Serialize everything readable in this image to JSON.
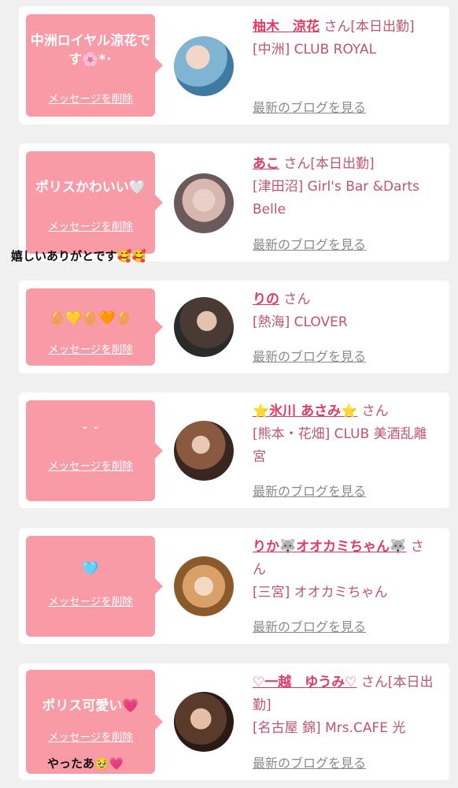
{
  "delete_label": "メッセージを削除",
  "blog_label": "最新のブログを見る",
  "honorific": "さん",
  "entries": [
    {
      "message": "中洲ロイヤル涼花です🌸*･",
      "name": "柚木　涼花",
      "status": "[本日出勤]",
      "shop": "[中洲] CLUB ROYAL",
      "extra": ""
    },
    {
      "message": "ポリスかわいい🤍",
      "name": "あこ",
      "status": "[本日出勤]",
      "shop": "[津田沼] Girl's Bar &Darts Belle",
      "extra": "嬉しいありがとです🥰🥰"
    },
    {
      "message": "🥚💛🥚🧡🥚",
      "name": "りの",
      "status": "",
      "shop": "[熱海] CLOVER",
      "extra": ""
    },
    {
      "message": "˘ ˘",
      "name": "⭐氷川 あさみ⭐",
      "status": "",
      "shop": "[熊本・花畑] CLUB 美酒乱離宮",
      "extra": ""
    },
    {
      "message": "🩵",
      "name": "りか🐺オオカミちゃん🐺",
      "status": "",
      "shop": "[三宮] オオカミちゃん",
      "extra": ""
    },
    {
      "message": "ポリス可愛い💗",
      "name": "♡一越　ゆうみ♡",
      "status": "[本日出勤]",
      "shop": "[名古屋 錦] Mrs.CAFE 光",
      "extra": "やったあ🥹💗"
    }
  ],
  "colors": {
    "bubble": "#f99aa7",
    "name": "#e33a63",
    "text": "#c0546e",
    "link": "#8a8a8a",
    "background": "#f0f0f0"
  }
}
